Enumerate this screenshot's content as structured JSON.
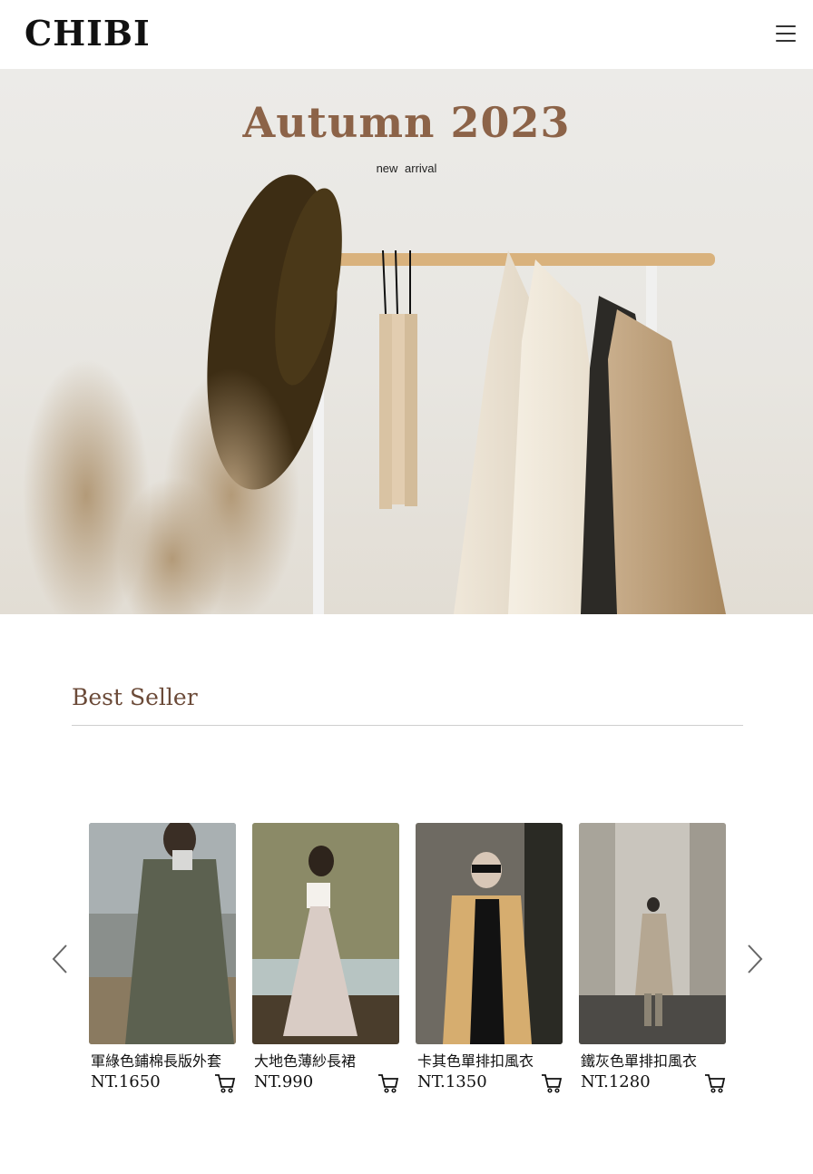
{
  "header": {
    "logo": "CHIBI",
    "menu_icon": "hamburger-menu-icon"
  },
  "hero": {
    "title": "Autumn 2023",
    "subtitle": "new  arrival"
  },
  "best_seller": {
    "title": "Best Seller",
    "prev_icon": "chevron-left-icon",
    "next_icon": "chevron-right-icon",
    "products": [
      {
        "name": "軍綠色鋪棉長版外套",
        "price": "NT.1650",
        "cart_icon": "cart-icon"
      },
      {
        "name": "大地色薄紗長裙",
        "price": "NT.990",
        "cart_icon": "cart-icon"
      },
      {
        "name": "卡其色單排扣風衣",
        "price": "NT.1350",
        "cart_icon": "cart-icon"
      },
      {
        "name": "鐵灰色單排扣風衣",
        "price": "NT.1280",
        "cart_icon": "cart-icon"
      }
    ]
  },
  "colors": {
    "hero_title": "#8c6348",
    "section_title": "#6b4a38",
    "background": "#ffffff"
  }
}
